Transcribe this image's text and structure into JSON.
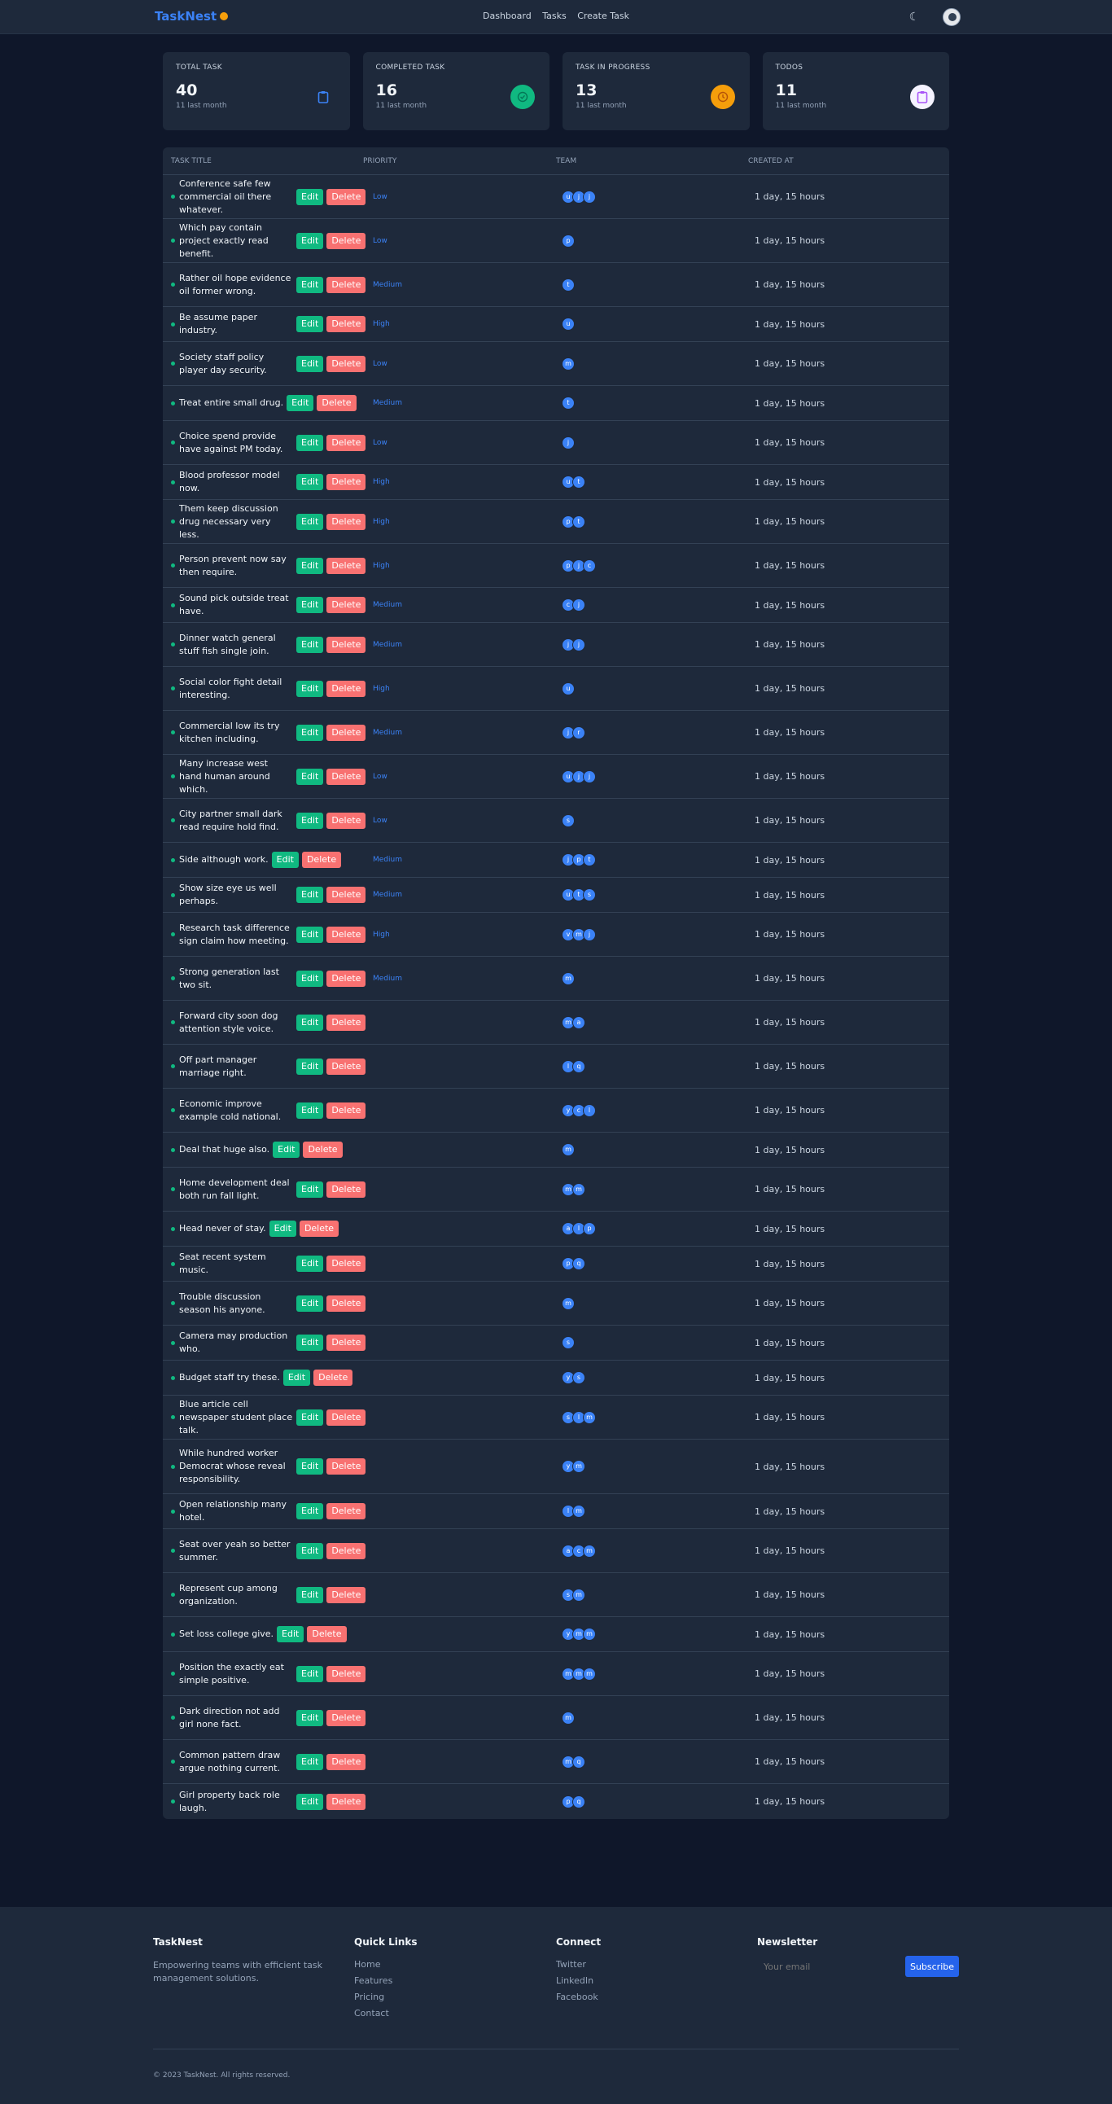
{
  "nav": {
    "brand": "TaskNest",
    "links": [
      "Dashboard",
      "Tasks",
      "Create Task"
    ]
  },
  "stats": [
    {
      "label": "TOTAL TASK",
      "value": "40",
      "sub": "11 last month",
      "icon": "clipboard-icon"
    },
    {
      "label": "COMPLETED TASK",
      "value": "16",
      "sub": "11 last month",
      "icon": "check-circle-icon"
    },
    {
      "label": "TASK IN PROGRESS",
      "value": "13",
      "sub": "11 last month",
      "icon": "clock-icon"
    },
    {
      "label": "TODOS",
      "value": "11",
      "sub": "11 last month",
      "icon": "clipboard-list-icon"
    }
  ],
  "table": {
    "headers": [
      "TASK TITLE",
      "PRIORITY",
      "TEAM",
      "CREATED AT"
    ],
    "edit_label": "Edit",
    "delete_label": "Delete",
    "rows": [
      {
        "title": "Conference safe few commercial oil there whatever.",
        "priority": "Low",
        "team": [
          "u",
          "j",
          "j"
        ],
        "created": "1 day, 15 hours"
      },
      {
        "title": "Which pay contain project exactly read benefit.",
        "priority": "Low",
        "team": [
          "p"
        ],
        "created": "1 day, 15 hours"
      },
      {
        "title": "Rather oil hope evidence oil former wrong.",
        "priority": "Medium",
        "team": [
          "t"
        ],
        "created": "1 day, 15 hours"
      },
      {
        "title": "Be assume paper industry.",
        "priority": "High",
        "team": [
          "u"
        ],
        "created": "1 day, 15 hours"
      },
      {
        "title": "Society staff policy player day security.",
        "priority": "Low",
        "team": [
          "m"
        ],
        "created": "1 day, 15 hours"
      },
      {
        "title": "Treat entire small drug.",
        "priority": "Medium",
        "team": [
          "t"
        ],
        "created": "1 day, 15 hours"
      },
      {
        "title": "Choice spend provide have against PM today.",
        "priority": "Low",
        "team": [
          "j"
        ],
        "created": "1 day, 15 hours"
      },
      {
        "title": "Blood professor model now.",
        "priority": "High",
        "team": [
          "u",
          "t"
        ],
        "created": "1 day, 15 hours"
      },
      {
        "title": "Them keep discussion drug necessary very less.",
        "priority": "High",
        "team": [
          "p",
          "t"
        ],
        "created": "1 day, 15 hours"
      },
      {
        "title": "Person prevent now say then require.",
        "priority": "High",
        "team": [
          "p",
          "j",
          "c"
        ],
        "created": "1 day, 15 hours"
      },
      {
        "title": "Sound pick outside treat have.",
        "priority": "Medium",
        "team": [
          "c",
          "j"
        ],
        "created": "1 day, 15 hours"
      },
      {
        "title": "Dinner watch general stuff fish single join.",
        "priority": "Medium",
        "team": [
          "j",
          "j"
        ],
        "created": "1 day, 15 hours"
      },
      {
        "title": "Social color fight detail interesting.",
        "priority": "High",
        "team": [
          "u"
        ],
        "created": "1 day, 15 hours"
      },
      {
        "title": "Commercial low its try kitchen including.",
        "priority": "Medium",
        "team": [
          "j",
          "r"
        ],
        "created": "1 day, 15 hours"
      },
      {
        "title": "Many increase west hand human around which.",
        "priority": "Low",
        "team": [
          "u",
          "j",
          "j"
        ],
        "created": "1 day, 15 hours"
      },
      {
        "title": "City partner small dark read require hold find.",
        "priority": "Low",
        "team": [
          "s"
        ],
        "created": "1 day, 15 hours"
      },
      {
        "title": "Side although work.",
        "priority": "Medium",
        "team": [
          "j",
          "p",
          "t"
        ],
        "created": "1 day, 15 hours"
      },
      {
        "title": "Show size eye us well perhaps.",
        "priority": "Medium",
        "team": [
          "u",
          "t",
          "s"
        ],
        "created": "1 day, 15 hours"
      },
      {
        "title": "Research task difference sign claim how meeting.",
        "priority": "High",
        "team": [
          "v",
          "m",
          "j"
        ],
        "created": "1 day, 15 hours"
      },
      {
        "title": "Strong generation last two sit.",
        "priority": "Medium",
        "team": [
          "m"
        ],
        "created": "1 day, 15 hours"
      },
      {
        "title": "Forward city soon dog attention style voice.",
        "priority": "",
        "team": [
          "m",
          "a"
        ],
        "created": "1 day, 15 hours"
      },
      {
        "title": "Off part manager marriage right.",
        "priority": "",
        "team": [
          "l",
          "q"
        ],
        "created": "1 day, 15 hours"
      },
      {
        "title": "Economic improve example cold national.",
        "priority": "",
        "team": [
          "y",
          "c",
          "l"
        ],
        "created": "1 day, 15 hours"
      },
      {
        "title": "Deal that huge also.",
        "priority": "",
        "team": [
          "m"
        ],
        "created": "1 day, 15 hours"
      },
      {
        "title": "Home development deal both run fall light.",
        "priority": "",
        "team": [
          "m",
          "m"
        ],
        "created": "1 day, 15 hours"
      },
      {
        "title": "Head never of stay.",
        "priority": "",
        "team": [
          "a",
          "l",
          "p"
        ],
        "created": "1 day, 15 hours"
      },
      {
        "title": "Seat recent system music.",
        "priority": "",
        "team": [
          "p",
          "q"
        ],
        "created": "1 day, 15 hours"
      },
      {
        "title": "Trouble discussion season his anyone.",
        "priority": "",
        "team": [
          "m"
        ],
        "created": "1 day, 15 hours"
      },
      {
        "title": "Camera may production who.",
        "priority": "",
        "team": [
          "s"
        ],
        "created": "1 day, 15 hours"
      },
      {
        "title": "Budget staff try these.",
        "priority": "",
        "team": [
          "y",
          "s"
        ],
        "created": "1 day, 15 hours"
      },
      {
        "title": "Blue article cell newspaper student place talk.",
        "priority": "",
        "team": [
          "s",
          "l",
          "m"
        ],
        "created": "1 day, 15 hours"
      },
      {
        "title": "While hundred worker Democrat whose reveal responsibility.",
        "priority": "",
        "team": [
          "y",
          "m"
        ],
        "created": "1 day, 15 hours"
      },
      {
        "title": "Open relationship many hotel.",
        "priority": "",
        "team": [
          "l",
          "m"
        ],
        "created": "1 day, 15 hours"
      },
      {
        "title": "Seat over yeah so better summer.",
        "priority": "",
        "team": [
          "a",
          "c",
          "m"
        ],
        "created": "1 day, 15 hours"
      },
      {
        "title": "Represent cup among organization.",
        "priority": "",
        "team": [
          "s",
          "m"
        ],
        "created": "1 day, 15 hours"
      },
      {
        "title": "Set loss college give.",
        "priority": "",
        "team": [
          "y",
          "m",
          "m"
        ],
        "created": "1 day, 15 hours"
      },
      {
        "title": "Position the exactly eat simple positive.",
        "priority": "",
        "team": [
          "m",
          "m",
          "m"
        ],
        "created": "1 day, 15 hours"
      },
      {
        "title": "Dark direction not add girl none fact.",
        "priority": "",
        "team": [
          "m"
        ],
        "created": "1 day, 15 hours"
      },
      {
        "title": "Common pattern draw argue nothing current.",
        "priority": "",
        "team": [
          "m",
          "q"
        ],
        "created": "1 day, 15 hours"
      },
      {
        "title": "Girl property back role laugh.",
        "priority": "",
        "team": [
          "p",
          "q"
        ],
        "created": "1 day, 15 hours"
      }
    ]
  },
  "footer": {
    "brand": "TaskNest",
    "tagline": "Empowering teams with efficient task management solutions.",
    "quick_links_title": "Quick Links",
    "quick_links": [
      "Home",
      "Features",
      "Pricing",
      "Contact"
    ],
    "connect_title": "Connect",
    "connect_links": [
      "Twitter",
      "LinkedIn",
      "Facebook"
    ],
    "newsletter_title": "Newsletter",
    "email_placeholder": "Your email",
    "subscribe_label": "Subscribe",
    "copyright": "© 2023 TaskNest. All rights reserved."
  },
  "colors": {
    "background": "#0f172a",
    "surface": "#1e293b",
    "accent": "#3b82f6",
    "edit": "#10b981",
    "delete": "#f87171"
  }
}
